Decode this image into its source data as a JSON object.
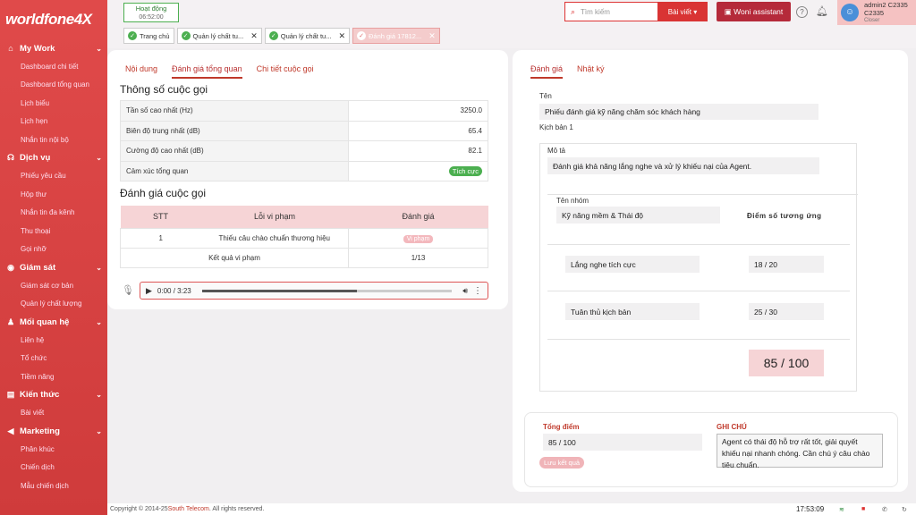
{
  "app": {
    "logo": "worldfone4X"
  },
  "sidebar": {
    "sections": [
      {
        "label": "My Work",
        "icon": "home-icon",
        "items": [
          "Dashboard chi tiết",
          "Dashboard tổng quan",
          "Lịch biểu",
          "Lịch hẹn",
          "Nhắn tin nội bộ"
        ]
      },
      {
        "label": "Dịch vụ",
        "icon": "headset-icon",
        "items": [
          "Phiếu yêu cầu",
          "Hộp thư",
          "Nhắn tin đa kênh",
          "Thu thoại",
          "Gọi nhỡ"
        ]
      },
      {
        "label": "Giám sát",
        "icon": "monitor-icon",
        "items": [
          "Giám sát cơ bản",
          "Quản lý chất lượng"
        ]
      },
      {
        "label": "Mối quan hệ",
        "icon": "users-icon",
        "items": [
          "Liên hệ",
          "Tổ chức",
          "Tiềm năng"
        ]
      },
      {
        "label": "Kiến thức",
        "icon": "book-icon",
        "items": [
          "Bài viết"
        ]
      },
      {
        "label": "Marketing",
        "icon": "megaphone-icon",
        "items": [
          "Phân khúc",
          "Chiến dịch",
          "Mẫu chiến dịch"
        ]
      }
    ]
  },
  "topbar": {
    "status": "Hoạt động",
    "timer": "06:52:00",
    "search_placeholder": "Tìm kiếm",
    "lang": "Bài viết",
    "assistant": "Woni assistant",
    "user_name": "admin2 C2335",
    "user_ext": "C2335",
    "user_role": "Closer",
    "tabs": [
      "Trang chủ",
      "Quản lý chất tu...",
      "Quản lý chất tu...",
      "Đánh giá 17812..."
    ]
  },
  "left": {
    "tabs": [
      "Nội dung",
      "Đánh giá tổng quan",
      "Chi tiết cuộc gọi"
    ],
    "params_title": "Thông số cuộc gọi",
    "params": [
      {
        "k": "Tần số cao nhất (Hz)",
        "v": "3250.0"
      },
      {
        "k": "Biên độ trung nhất (dB)",
        "v": "65.4"
      },
      {
        "k": "Cường độ cao nhất (dB)",
        "v": "82.1"
      },
      {
        "k": "Cảm xúc tổng quan",
        "v": "Tích cực"
      }
    ],
    "eval_title": "Đánh giá cuộc gọi",
    "eval_headers": [
      "STT",
      "Lỗi vi phạm",
      "Đánh giá"
    ],
    "eval_row": {
      "stt": "1",
      "err": "Thiếu câu chào chuẩn thương hiệu",
      "rate": "Vi phạm"
    },
    "eval_result": {
      "label": "Kết quả vi phạm",
      "value": "1/13"
    },
    "audio": {
      "time": "0:00 / 3:23",
      "progress": 0.62
    }
  },
  "right": {
    "tabs": [
      "Đánh giá",
      "Nhật ký"
    ],
    "name_label": "Tên",
    "name_value": "Phiếu đánh giá kỹ năng chăm sóc khách hàng",
    "script": "Kịch bản 1",
    "desc_label": "Mô tả",
    "desc_value": "Đánh giá khả năng lắng nghe và xử lý khiếu nại của Agent.",
    "group_label": "Tên nhóm",
    "group_value": "Kỹ năng mềm & Thái độ",
    "score_header": "Điểm số tương ứng",
    "criteria": [
      {
        "name": "Lắng nghe tích cực",
        "score": "18 / 20"
      },
      {
        "name": "Tuân thủ kịch bản",
        "score": "25 / 30"
      }
    ],
    "total_box": "85 / 100",
    "total_label": "Tổng điểm",
    "total_value": "85 / 100",
    "save": "Lưu kết quả",
    "note_label": "GHI CHÚ",
    "note_value": "Agent có thái độ hỗ trợ rất tốt, giải quyết khiếu nại nhanh chóng. Cần chú ý câu chào tiêu chuẩn."
  },
  "footer": {
    "copyright_pre": "Copyright © 2014-25 ",
    "company": "South Telecom",
    "copyright_post": ". All rights reserved.",
    "time": "17:53:09"
  },
  "colors": {
    "brand": "#d93434",
    "accent": "#c0392b",
    "success": "#4caf50"
  }
}
